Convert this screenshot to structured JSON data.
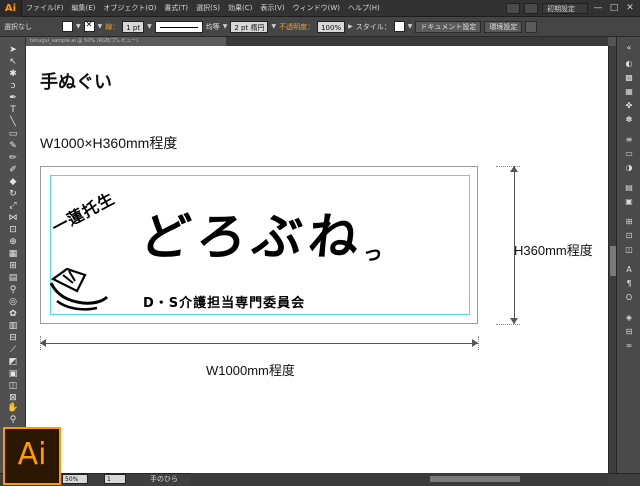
{
  "app": {
    "logo_small": "Ai",
    "logo_large": "Ai",
    "accent": "#ff9a00"
  },
  "menubar": {
    "items": [
      "ファイル(F)",
      "編集(E)",
      "オブジェクト(O)",
      "書式(T)",
      "選択(S)",
      "効果(C)",
      "表示(V)",
      "ウィンドウ(W)",
      "ヘルプ(H)"
    ],
    "workspace": "初期設定",
    "window_controls": [
      "—",
      "□",
      "✕"
    ]
  },
  "controlbar": {
    "selection": "選択なし",
    "stroke_label": "線：",
    "stroke_weight": "1 pt",
    "stroke_profile": "均等",
    "brush": "2 pt 楕円",
    "opacity_label": "不透明度：",
    "opacity_value": "100%",
    "style_label": "スタイル：",
    "doc_setup": "ドキュメント設定",
    "preferences": "環境設定"
  },
  "document_tab": {
    "title": "tenugui_sample.ai @ 50% (RGB/プレビュー)"
  },
  "canvas": {
    "title": "手ぬぐい",
    "size_label": "W1000×H360mm程度",
    "design": {
      "sub_text": "一蓮托生",
      "main_text": "どろぶね",
      "main_small": "っ",
      "org_text": "D・S介護担当専門委員会"
    },
    "width_label": "W1000mm程度",
    "height_label": "H360mm程度"
  },
  "statusbar": {
    "zoom": "50%",
    "page": "1",
    "tool": "手のひら"
  },
  "tools": [
    "selection-tool",
    "direct-selection-tool",
    "magic-wand-tool",
    "lasso-tool",
    "pen-tool",
    "type-tool",
    "line-tool",
    "rectangle-tool",
    "paintbrush-tool",
    "pencil-tool",
    "blob-brush-tool",
    "eraser-tool",
    "rotate-tool",
    "scale-tool",
    "width-tool",
    "free-transform-tool",
    "shape-builder-tool",
    "perspective-grid-tool",
    "mesh-tool",
    "gradient-tool",
    "eyedropper-tool",
    "blend-tool",
    "symbol-sprayer-tool",
    "column-graph-tool",
    "artboard-tool",
    "slice-tool",
    "hand-tool",
    "zoom-tool"
  ]
}
